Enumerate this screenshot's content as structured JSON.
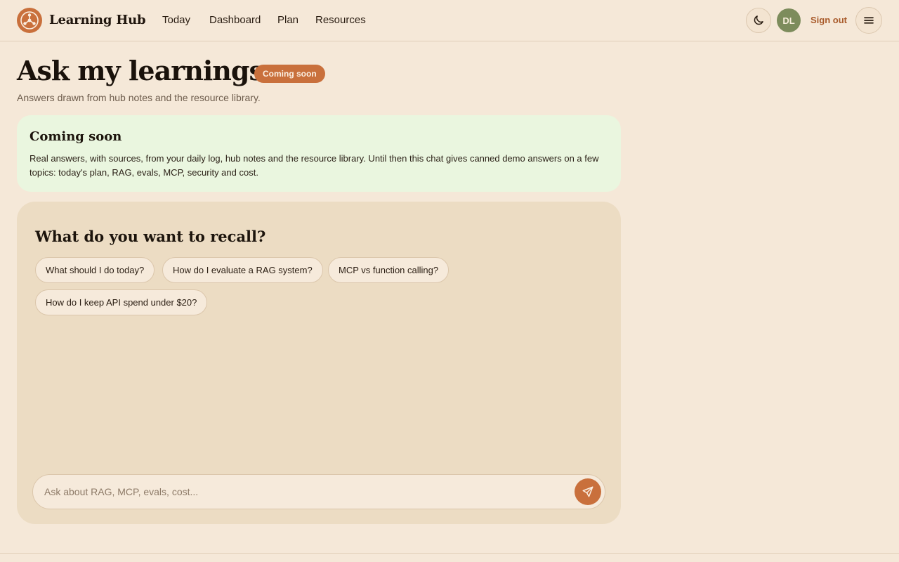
{
  "header": {
    "brand": "Learning Hub",
    "nav": [
      "Today",
      "Dashboard",
      "Plan",
      "Resources"
    ],
    "avatar_initials": "DL",
    "sign_out": "Sign out",
    "icons": {
      "logo": "hub-logo-icon",
      "theme": "moon-icon",
      "menu": "hamburger-icon"
    }
  },
  "page": {
    "title": "Ask my learnings",
    "badge": "Coming soon",
    "subtitle": "Answers drawn from hub notes and the resource library."
  },
  "notice": {
    "title": "Coming soon",
    "body": "Real answers, with sources, from your daily log, hub notes and the resource library. Until then this chat gives canned demo answers on a few topics: today's plan, RAG, evals, MCP, security and cost."
  },
  "chat": {
    "title": "What do you want to recall?",
    "suggestions": [
      "What should I do today?",
      "How do I evaluate a RAG system?",
      "MCP vs function calling?",
      "How do I keep API spend under $20?"
    ],
    "input_placeholder": "Ask about RAG, MCP, evals, cost...",
    "send_icon": "send-icon"
  },
  "colors": {
    "background": "#f5e8d8",
    "accent": "#c9703c",
    "notice_bg": "#eaf6df",
    "chat_bg": "#ecdcc3",
    "avatar_bg": "#7d8c5c"
  }
}
